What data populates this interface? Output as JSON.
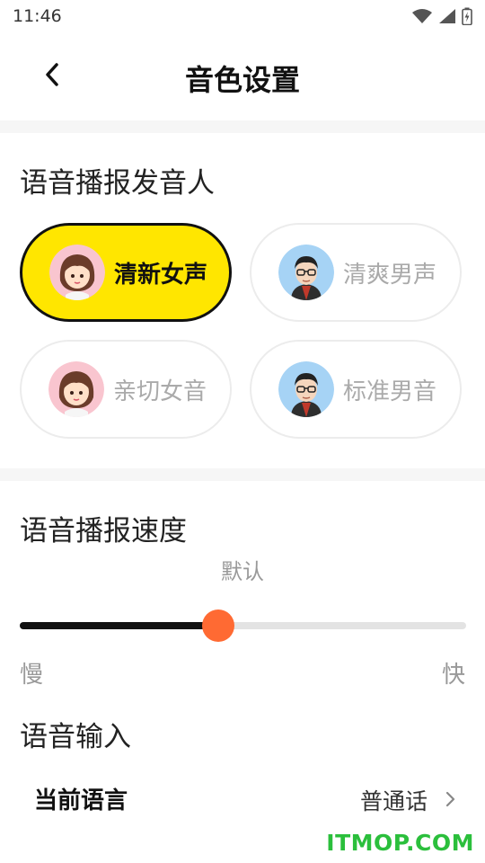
{
  "status_bar": {
    "time": "11:46"
  },
  "header": {
    "title": "音色设置"
  },
  "voice_section": {
    "title": "语音播报发音人",
    "voices": [
      {
        "label": "清新女声",
        "avatar": "girl-avatar",
        "selected": true
      },
      {
        "label": "清爽男声",
        "avatar": "man-glasses-avatar",
        "selected": false
      },
      {
        "label": "亲切女音",
        "avatar": "girl-avatar",
        "selected": false
      },
      {
        "label": "标准男音",
        "avatar": "man-glasses-avatar",
        "selected": false
      }
    ]
  },
  "speed_section": {
    "title": "语音播报速度",
    "current": "默认",
    "slider_fraction": 0.445,
    "slow_label": "慢",
    "fast_label": "快"
  },
  "input_section": {
    "title": "语音输入",
    "language_label": "当前语言",
    "language_value": "普通话"
  },
  "watermark": "ITMOP.COM",
  "colors": {
    "accent_yellow": "#ffe600",
    "slider_thumb": "#ff6a33",
    "watermark_green": "#2bbf3c"
  }
}
